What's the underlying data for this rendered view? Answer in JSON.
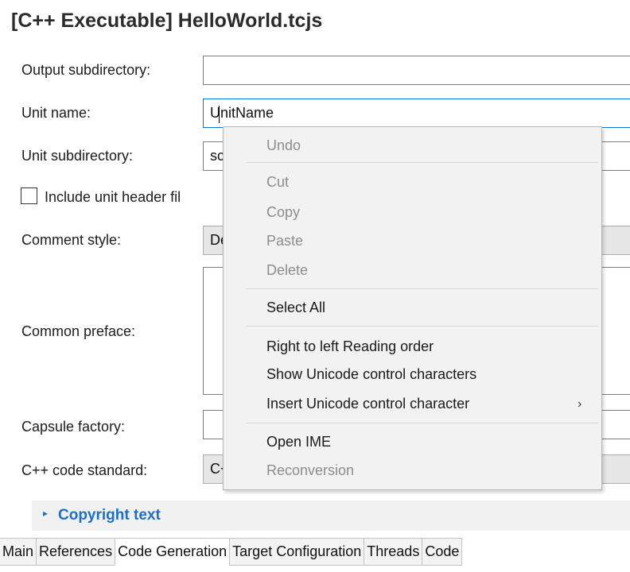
{
  "window_title": "[C++ Executable] HelloWorld.tcjs",
  "form": {
    "output_subdirectory": {
      "label": "Output subdirectory:",
      "value": ""
    },
    "unit_name": {
      "label": "Unit name:",
      "value": "UnitName"
    },
    "unit_subdirectory": {
      "label": "Unit subdirectory:",
      "value": "sc"
    },
    "include_unit_header": {
      "label": "Include unit header fil",
      "checked": false
    },
    "comment_style": {
      "label": "Comment style:",
      "value": "De"
    },
    "common_preface": {
      "label": "Common preface:",
      "value": ""
    },
    "capsule_factory": {
      "label": "Capsule factory:",
      "value": ""
    },
    "cpp_code_standard": {
      "label": "C++ code standard:",
      "value": "C+"
    }
  },
  "section": {
    "title": "Copyright text",
    "expanded": false
  },
  "tabs": [
    {
      "label": "Main",
      "active": false
    },
    {
      "label": "References",
      "active": false
    },
    {
      "label": "Code Generation",
      "active": true
    },
    {
      "label": "Target Configuration",
      "active": false
    },
    {
      "label": "Threads",
      "active": false
    },
    {
      "label": "Code",
      "active": false
    }
  ],
  "context_menu": {
    "undo": "Undo",
    "cut": "Cut",
    "copy": "Copy",
    "paste": "Paste",
    "delete": "Delete",
    "select_all": "Select All",
    "rtl_reading_order": "Right to left Reading order",
    "show_unicode": "Show Unicode control characters",
    "insert_unicode": "Insert Unicode control character",
    "open_ime": "Open IME",
    "reconversion": "Reconversion",
    "submenu_arrow": "›"
  },
  "icons": {
    "section_arrow": "▸"
  },
  "colors": {
    "accent": "#1f6fc5",
    "focus_border": "#0078d7",
    "disabled_text": "#8d8d8d"
  }
}
